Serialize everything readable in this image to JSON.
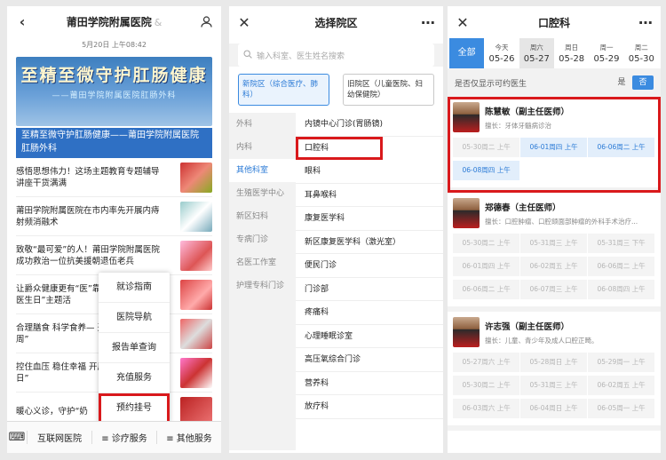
{
  "panel1": {
    "title": "莆田学院附属医院",
    "title_suffix": "&",
    "date": "5月20日 上午08:42",
    "banner_title": "至精至微守护肛肠健康",
    "banner_subtitle": "——莆田学院附属医院肛肠外科",
    "banner_caption": "至精至微守护肛肠健康——莆田学院附属医院肛肠外科",
    "news": [
      "感悟思想伟力！这场主题教育专题辅导讲座干货满满",
      "莆田学院附属医院在市内率先开展内痔射频消融术",
      "致敬“最可爱”的人！莆田学院附属医院成功救治一位抗美援朝退伍老兵",
      "让爵众健康更有“医”靠！“护”世界家庭医生日”主题活",
      "合理膳食 科学食养— 开展“全民营养周”",
      "控住血压 稳住幸福 开展“世界高血压日”",
      "暖心义诊，守护“奶"
    ],
    "menu": [
      "就诊指南",
      "医院导航",
      "报告单查询",
      "充值服务",
      "预约挂号"
    ],
    "tabbar": [
      "互联网医院",
      "诊疗服务",
      "其他服务"
    ]
  },
  "panel2": {
    "title": "选择院区",
    "search_placeholder": "输入科室、医生姓名搜索",
    "campus_new": "新院区（综合医疗、肺科）",
    "campus_old": "旧院区（儿童医院、妇幼保健院）",
    "left_nav": [
      "外科",
      "内科",
      "其他科室",
      "生殖医学中心",
      "新区妇科",
      "专病门诊",
      "名医工作室",
      "护理专科门诊"
    ],
    "departments": [
      "内镜中心门诊(胃肠镜)",
      "口腔科",
      "眼科",
      "耳鼻喉科",
      "康复医学科",
      "新区康复医学科（激光室）",
      "便民门诊",
      "门诊部",
      "疼痛科",
      "心理睡眠诊室",
      "高压氧综合门诊",
      "营养科",
      "放疗科"
    ]
  },
  "panel3": {
    "title": "口腔科",
    "dates": [
      {
        "w": "全部",
        "d": ""
      },
      {
        "w": "今天",
        "d": "05-26"
      },
      {
        "w": "周六",
        "d": "05-27"
      },
      {
        "w": "周日",
        "d": "05-28"
      },
      {
        "w": "周一",
        "d": "05-29"
      },
      {
        "w": "周二",
        "d": "05-30"
      }
    ],
    "toggle_label": "是否仅显示可约医生",
    "toggle_yes": "是",
    "toggle_no": "否",
    "doctors": [
      {
        "name": "陈慧敏（副主任医师）",
        "spec": "擅长：牙体牙髓病诊治",
        "slots": [
          "05-30周二 上午",
          "06-01周四 上午",
          "06-06周二 上午",
          "06-08周四 上午"
        ]
      },
      {
        "name": "郑德春（主任医师）",
        "spec": "擅长：口腔肿瘤、口腔颌面部肿瘤的外科手术治疗...",
        "slots": [
          "05-30周二 上午",
          "05-31周三 上午",
          "05-31周三 下午",
          "06-01周四 上午",
          "06-02周五 上午",
          "06-06周二 上午",
          "06-06周二 上午",
          "06-07周三 上午",
          "06-08周四 上午"
        ]
      },
      {
        "name": "许志强（副主任医师）",
        "spec": "擅长：儿童、青少年及成人口腔正畸。",
        "slots": [
          "05-27周六 上午",
          "05-28周日 上午",
          "05-29周一 上午",
          "05-30周二 上午",
          "05-31周三 上午",
          "06-02周五 上午",
          "06-03周六 上午",
          "06-04周日 上午",
          "06-05周一 上午"
        ]
      }
    ]
  }
}
